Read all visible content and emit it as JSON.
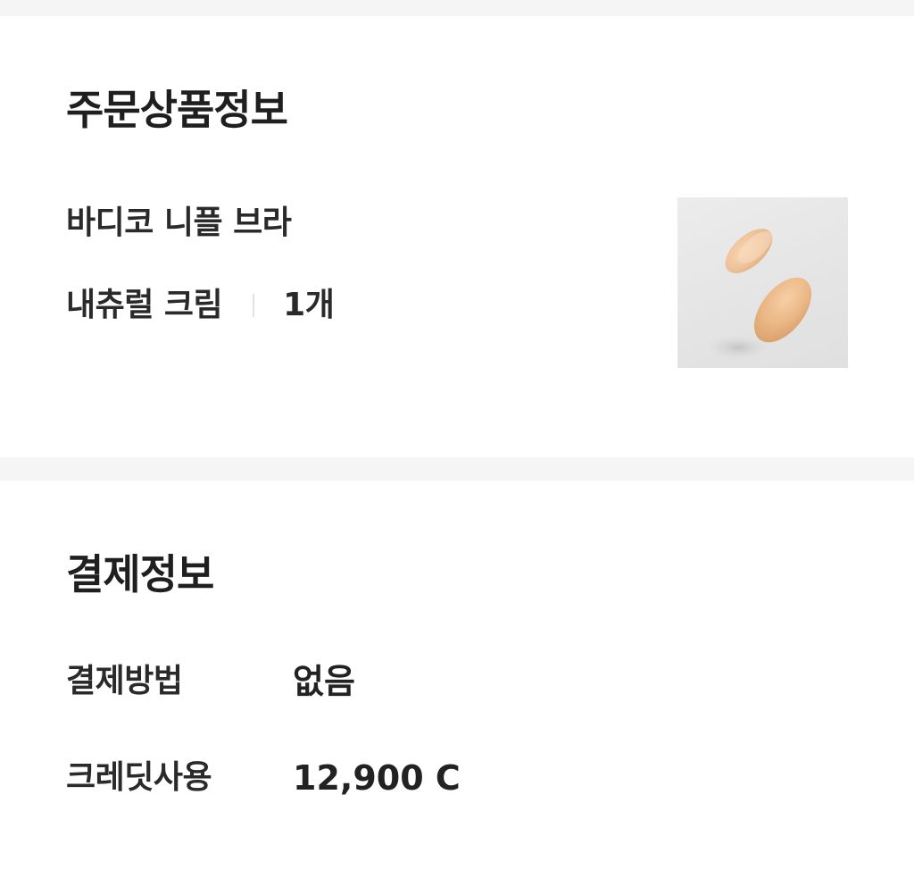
{
  "order_section": {
    "title": "주문상품정보",
    "product": {
      "name": "바디코 니플 브라",
      "option": "내츄럴 크림",
      "quantity": "1개",
      "image": "nipple-pad-product-photo"
    }
  },
  "payment_section": {
    "title": "결제정보",
    "rows": [
      {
        "label": "결제방법",
        "value": "없음"
      },
      {
        "label": "크레딧사용",
        "value": "12,900 C"
      }
    ]
  },
  "colors": {
    "background": "#ffffff",
    "separator": "#f5f5f5",
    "text": "#222222",
    "product_tone": "#e8b98c"
  }
}
